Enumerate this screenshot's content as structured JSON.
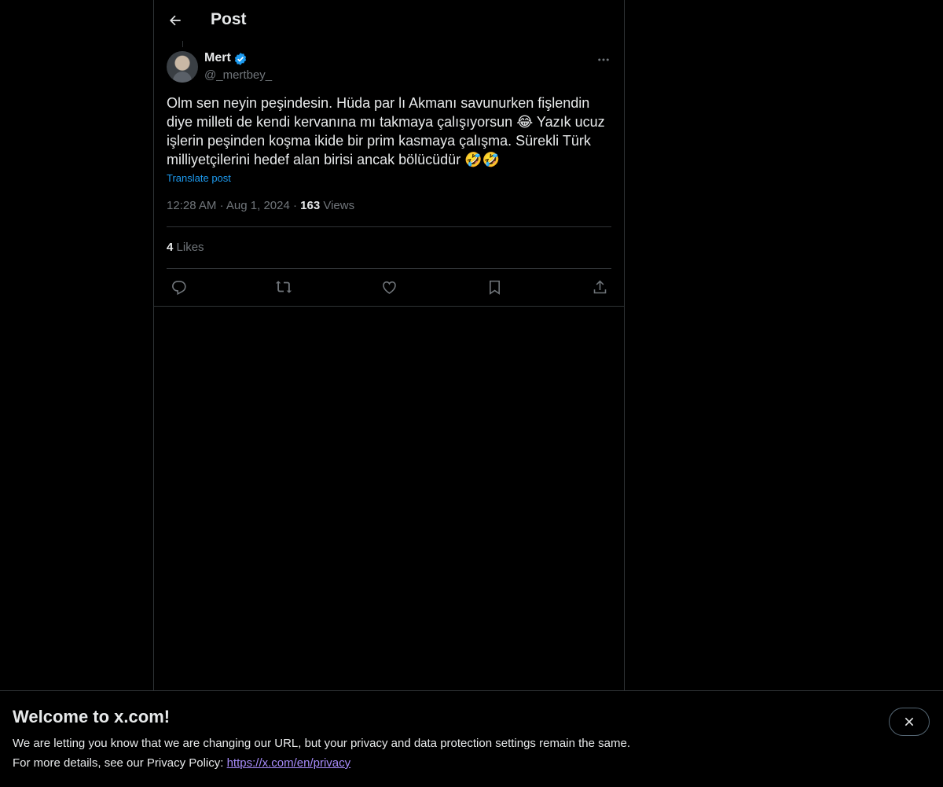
{
  "header": {
    "title": "Post"
  },
  "post": {
    "author_name": "Mert",
    "author_handle": "@_mertbey_",
    "text": "Olm sen neyin peşindesin. Hüda par lı Akmanı savunurken fişlendin diye milleti de kendi kervanına mı takmaya çalışıyorsun 😂 Yazık ucuz işlerin peşinden koşma ikide bir prim kasmaya çalışma. Sürekli Türk milliyetçilerini hedef alan birisi ancak bölücüdür 🤣🤣",
    "translate_label": "Translate post",
    "time": "12:28 AM",
    "date": "Aug 1, 2024",
    "separator": "·",
    "views_count": "163",
    "views_label": "Views",
    "likes_count": "4",
    "likes_label": "Likes"
  },
  "actions": [
    "reply-icon",
    "repost-icon",
    "like-icon",
    "bookmark-icon",
    "share-icon"
  ],
  "banner": {
    "title": "Welcome to x.com!",
    "line1": "We are letting you know that we are changing our URL, but your privacy and data protection settings remain the same.",
    "line2_prefix": "For more details, see our Privacy Policy: ",
    "link": "https://x.com/en/privacy"
  },
  "colors": {
    "accent": "#1d9bf0",
    "text": "#e7e9ea",
    "muted": "#71767b",
    "border": "#2f3336",
    "link_visited": "#a78bfa"
  }
}
